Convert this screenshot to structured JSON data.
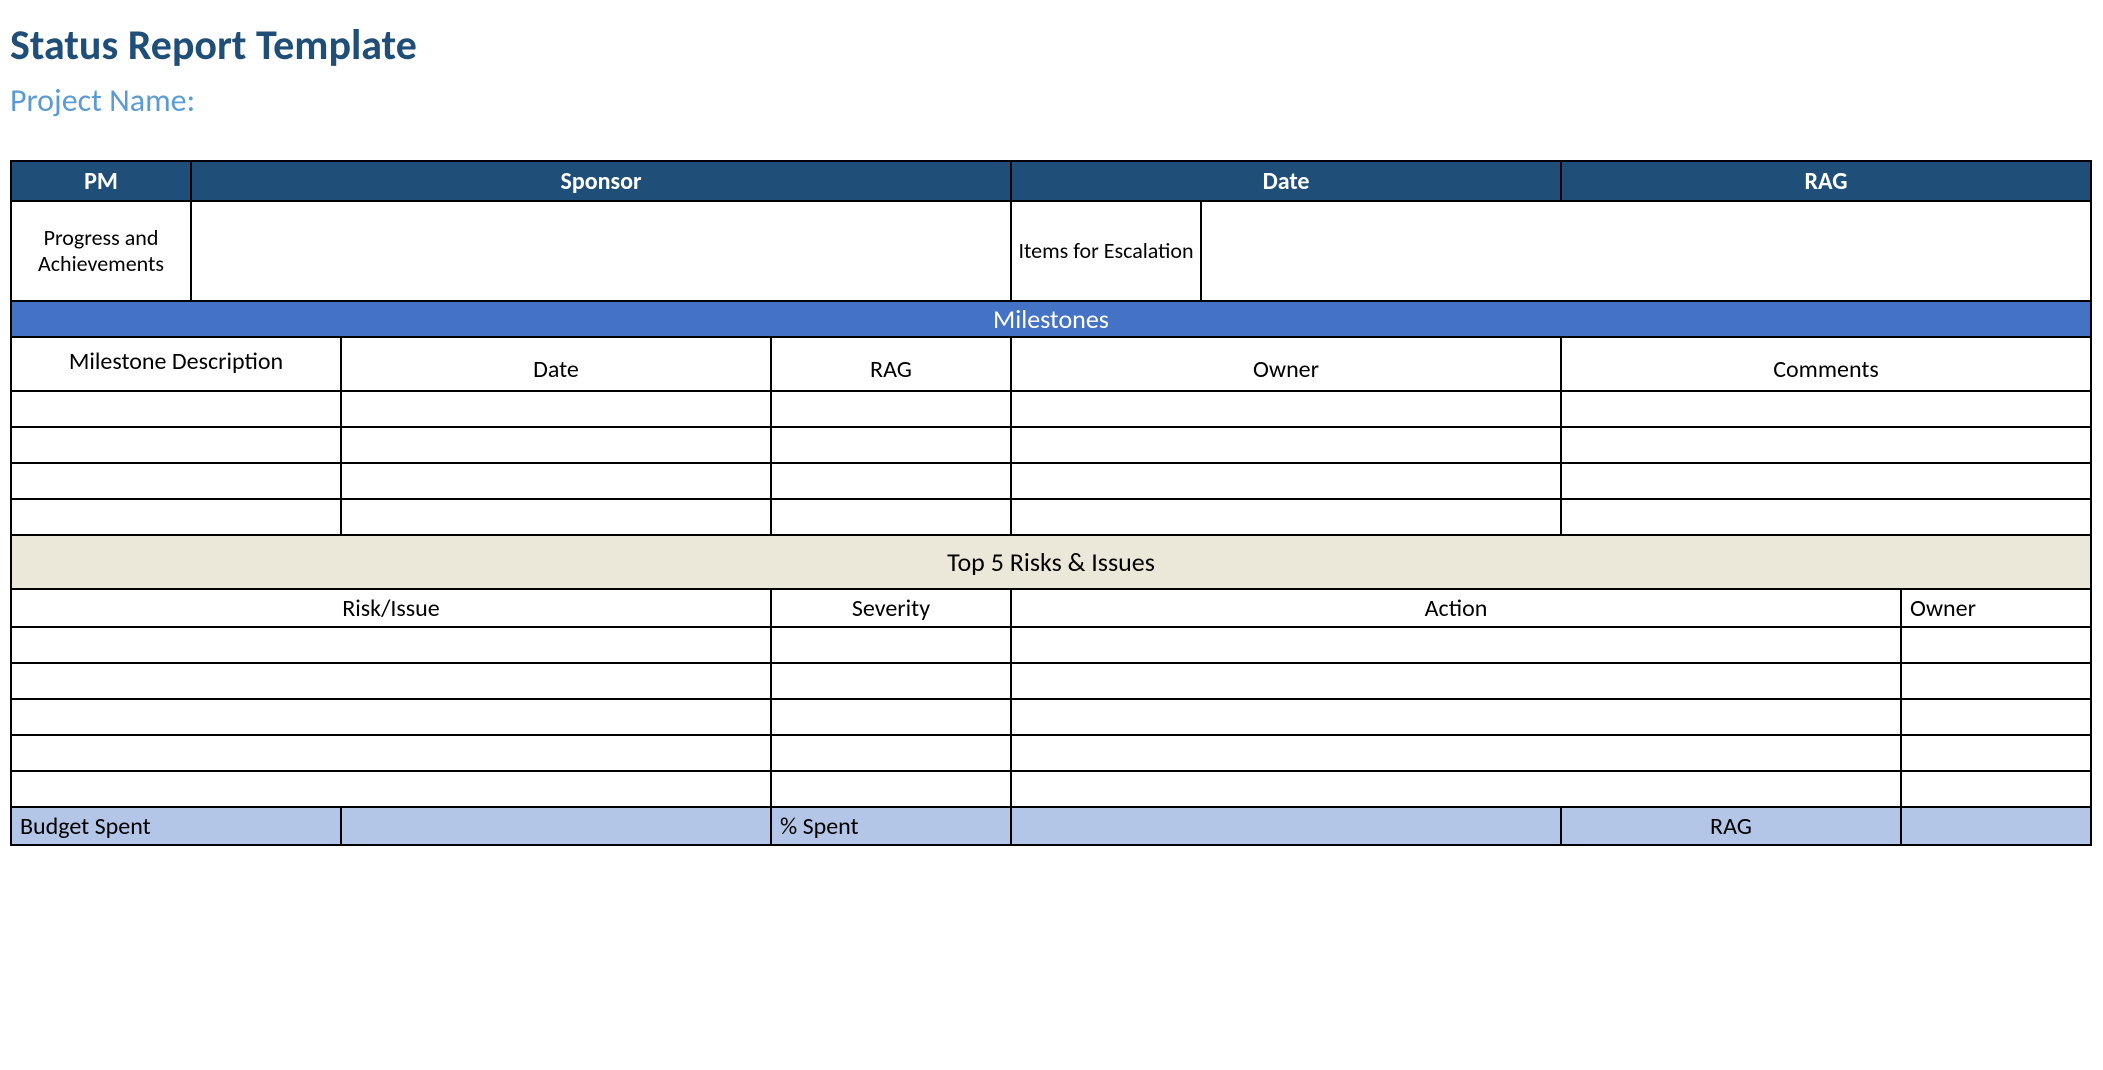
{
  "title": "Status Report Template",
  "subtitle": "Project Name:",
  "header": {
    "pm": "PM",
    "sponsor": "Sponsor",
    "date": "Date",
    "rag": "RAG"
  },
  "sections": {
    "progress": "Progress and Achievements",
    "escalation": "Items for Escalation"
  },
  "milestones": {
    "title": "Milestones",
    "cols": {
      "desc": "Milestone Description",
      "date": "Date",
      "rag": "RAG",
      "owner": "Owner",
      "comments": "Comments"
    }
  },
  "risks": {
    "title": "Top 5 Risks & Issues",
    "cols": {
      "risk": "Risk/Issue",
      "severity": "Severity",
      "action": "Action",
      "owner": "Owner"
    }
  },
  "budget": {
    "spent": "Budget Spent",
    "pct": "% Spent",
    "rag": "RAG"
  }
}
